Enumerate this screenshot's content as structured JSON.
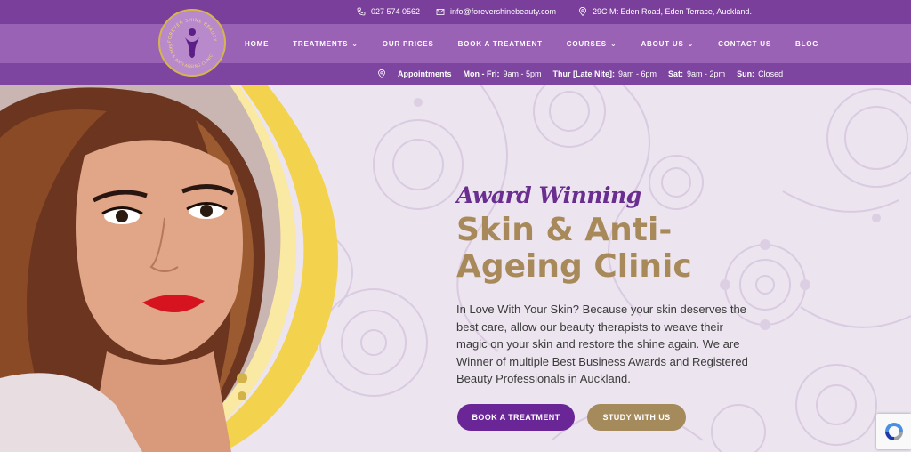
{
  "topbar": {
    "phone": "027 574 0562",
    "email": "info@forevershinebeauty.com",
    "address": "29C Mt Eden Road, Eden Terrace, Auckland."
  },
  "logo": {
    "text_top": "FOREVER SHINE BEAUTY",
    "text_bottom": "SKIN & ANTI-AGEING CLINIC"
  },
  "nav": {
    "items": [
      {
        "label": "HOME",
        "dropdown": false
      },
      {
        "label": "TREATMENTS",
        "dropdown": true
      },
      {
        "label": "OUR PRICES",
        "dropdown": false
      },
      {
        "label": "BOOK A TREATMENT",
        "dropdown": false
      },
      {
        "label": "COURSES",
        "dropdown": true
      },
      {
        "label": "ABOUT US",
        "dropdown": true
      },
      {
        "label": "CONTACT US",
        "dropdown": false
      },
      {
        "label": "BLOG",
        "dropdown": false
      }
    ]
  },
  "appointments": {
    "label": "Appointments",
    "d1": "Mon - Fri:",
    "h1": "9am - 5pm",
    "d2": "Thur [Late Nite]:",
    "h2": "9am - 6pm",
    "d3": "Sat:",
    "h3": "9am - 2pm",
    "d4": "Sun:",
    "h4": "Closed"
  },
  "hero": {
    "script_title": "Award Winning",
    "headline_line1": "Skin & Anti-",
    "headline_line2": "Ageing Clinic",
    "description": "In Love With Your Skin? Because your skin deserves the best care, allow our beauty therapists to weave their magic on your skin and restore the shine again. We are Winner of multiple Best Business Awards and Registered Beauty Professionals in Auckland.",
    "btn_book": "BOOK A TREATMENT",
    "btn_study": "STUDY WITH US"
  },
  "colors": {
    "topbar": "#7a3f9b",
    "navbar": "#9a62b4",
    "accent_purple": "#6a2596",
    "accent_gold": "#a58a5c",
    "hero_bg": "#ece4ef"
  }
}
